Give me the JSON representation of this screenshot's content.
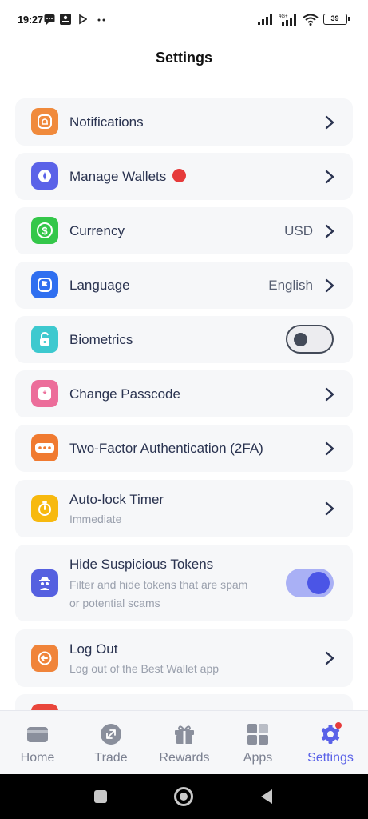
{
  "status_bar": {
    "time": "19:27",
    "battery": "39"
  },
  "header": {
    "title": "Settings"
  },
  "settings": {
    "notifications": {
      "label": "Notifications"
    },
    "manage_wallets": {
      "label": "Manage Wallets"
    },
    "currency": {
      "label": "Currency",
      "value": "USD"
    },
    "language": {
      "label": "Language",
      "value": "English"
    },
    "biometrics": {
      "label": "Biometrics",
      "enabled": false
    },
    "change_passcode": {
      "label": "Change Passcode"
    },
    "two_factor": {
      "label": "Two-Factor Authentication (2FA)"
    },
    "auto_lock": {
      "label": "Auto-lock Timer",
      "subtitle": "Immediate"
    },
    "hide_tokens": {
      "label": "Hide Suspicious Tokens",
      "subtitle_line1": "Filter and hide tokens that are spam",
      "subtitle_line2": "or potential scams",
      "enabled": true
    },
    "log_out": {
      "label": "Log Out",
      "subtitle": "Log out of the Best Wallet app"
    }
  },
  "tabs": [
    {
      "label": "Home",
      "icon": "wallet-icon",
      "active": false
    },
    {
      "label": "Trade",
      "icon": "trade-icon",
      "active": false
    },
    {
      "label": "Rewards",
      "icon": "gift-icon",
      "active": false
    },
    {
      "label": "Apps",
      "icon": "apps-grid-icon",
      "active": false
    },
    {
      "label": "Settings",
      "icon": "gear-icon",
      "active": true
    }
  ],
  "colors": {
    "accent": "#5a62e8",
    "notifications_icon": "#f08a3c",
    "wallets_icon": "#5a62e8",
    "currency_icon": "#34c74a",
    "language_icon": "#2f6ff0",
    "biometrics_icon": "#3dc9cf",
    "passcode_icon": "#ec6d9a",
    "twofa_icon": "#f07a30",
    "autolock_icon": "#f7b90f",
    "hide_tokens_icon": "#5560e0",
    "logout_icon": "#f0843a",
    "badge": "#e63b3b"
  }
}
